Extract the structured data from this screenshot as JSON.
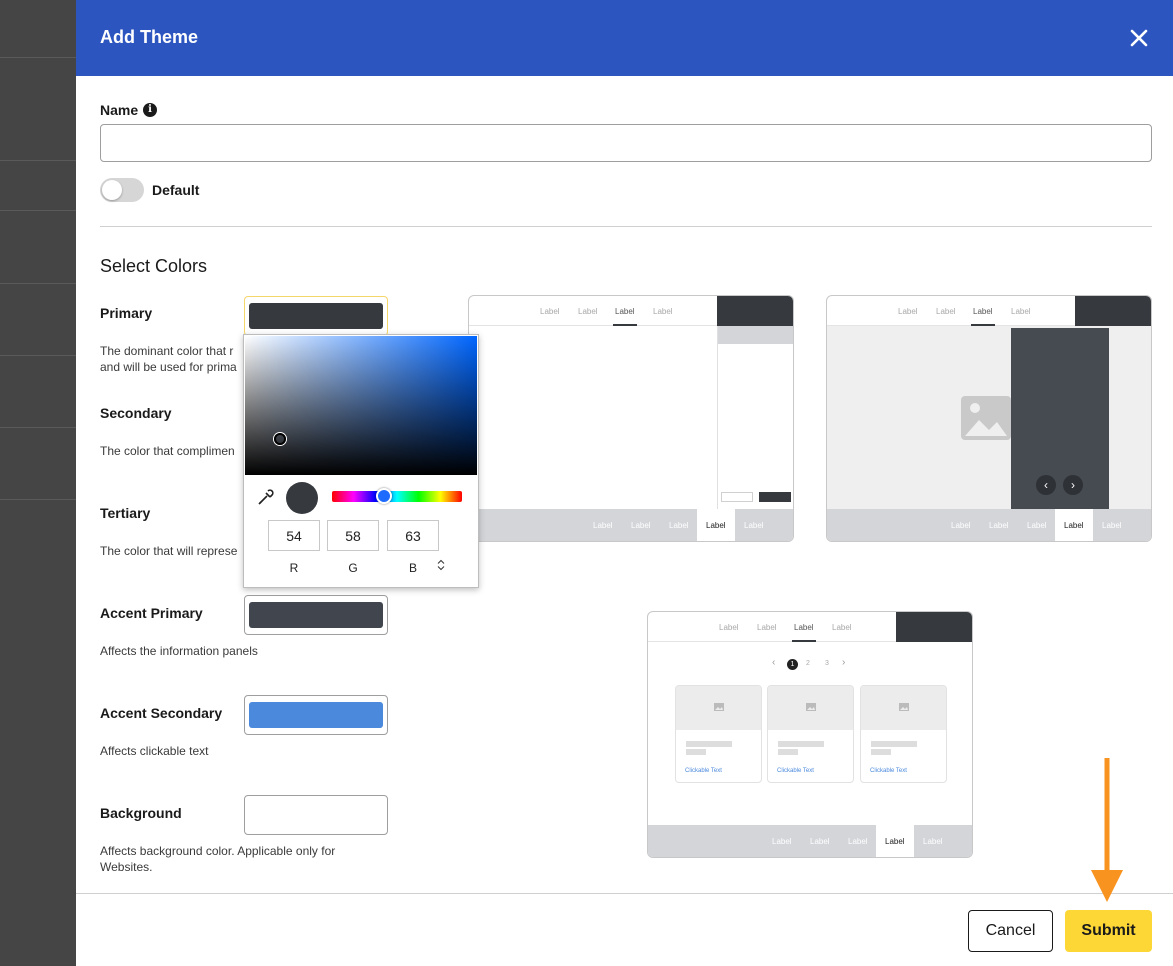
{
  "modal": {
    "title": "Add Theme",
    "close_icon": "close-icon"
  },
  "name_field": {
    "label": "Name",
    "value": "",
    "placeholder": ""
  },
  "default_toggle": {
    "label": "Default",
    "on": false
  },
  "section_title": "Select Colors",
  "colors": [
    {
      "label": "Primary",
      "desc": "The dominant color that r",
      "desc2": "and will be used for prima",
      "color": "#363a3f"
    },
    {
      "label": "Secondary",
      "desc": "The color that complimen",
      "color": ""
    },
    {
      "label": "Tertiary",
      "desc": "The color that will represe",
      "color": ""
    },
    {
      "label": "Accent Primary",
      "desc": "Affects the information panels",
      "color": "#41464e"
    },
    {
      "label": "Accent Secondary",
      "desc": "Affects clickable text",
      "color": "#4a89dc"
    },
    {
      "label": "Background",
      "desc": "Affects background color. Applicable only for",
      "desc2": "Websites.",
      "color": "#ffffff"
    }
  ],
  "picker": {
    "r": "54",
    "g": "58",
    "b": "63",
    "r_label": "R",
    "g_label": "G",
    "b_label": "B",
    "toggle_glyph": "⌃⌄"
  },
  "mockups": {
    "tab_labels": [
      "Label",
      "Label",
      "Label",
      "Label"
    ],
    "footer_labels": [
      "Label",
      "Label",
      "Label",
      "Label",
      "Label"
    ],
    "pagination": [
      "1",
      "2",
      "3"
    ],
    "card_link": "Clickable Text"
  },
  "footer": {
    "cancel_label": "Cancel",
    "submit_label": "Submit"
  },
  "annotation": {
    "arrow_color": "#f7931e"
  }
}
